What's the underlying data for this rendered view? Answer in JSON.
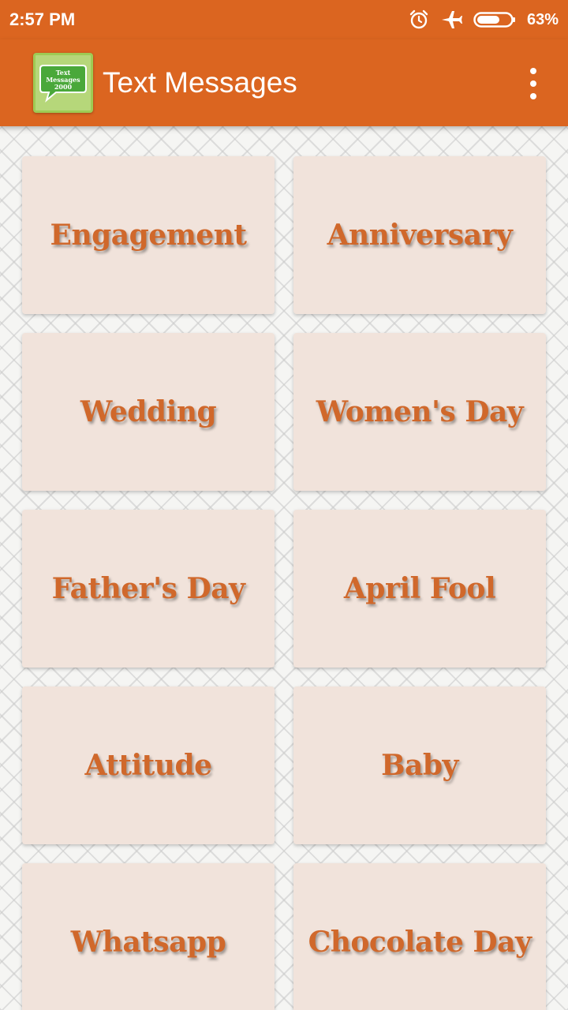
{
  "status_bar": {
    "time": "2:57 PM",
    "battery_percent": "63%",
    "icons": [
      "alarm-icon",
      "airplane-icon",
      "battery-icon"
    ]
  },
  "app_bar": {
    "title": "Text Messages",
    "logo_lines": [
      "Text",
      "Messages",
      "2000"
    ],
    "menu_icon": "more-vert-icon"
  },
  "colors": {
    "primary": "#db6520",
    "card_bg": "#f1e3db",
    "card_text": "#d0682b"
  },
  "categories": [
    {
      "label": "Engagement"
    },
    {
      "label": "Anniversary"
    },
    {
      "label": "Wedding"
    },
    {
      "label": "Women's Day"
    },
    {
      "label": "Father's Day"
    },
    {
      "label": "April Fool"
    },
    {
      "label": "Attitude"
    },
    {
      "label": "Baby"
    },
    {
      "label": "Whatsapp"
    },
    {
      "label": "Chocolate Day"
    }
  ]
}
